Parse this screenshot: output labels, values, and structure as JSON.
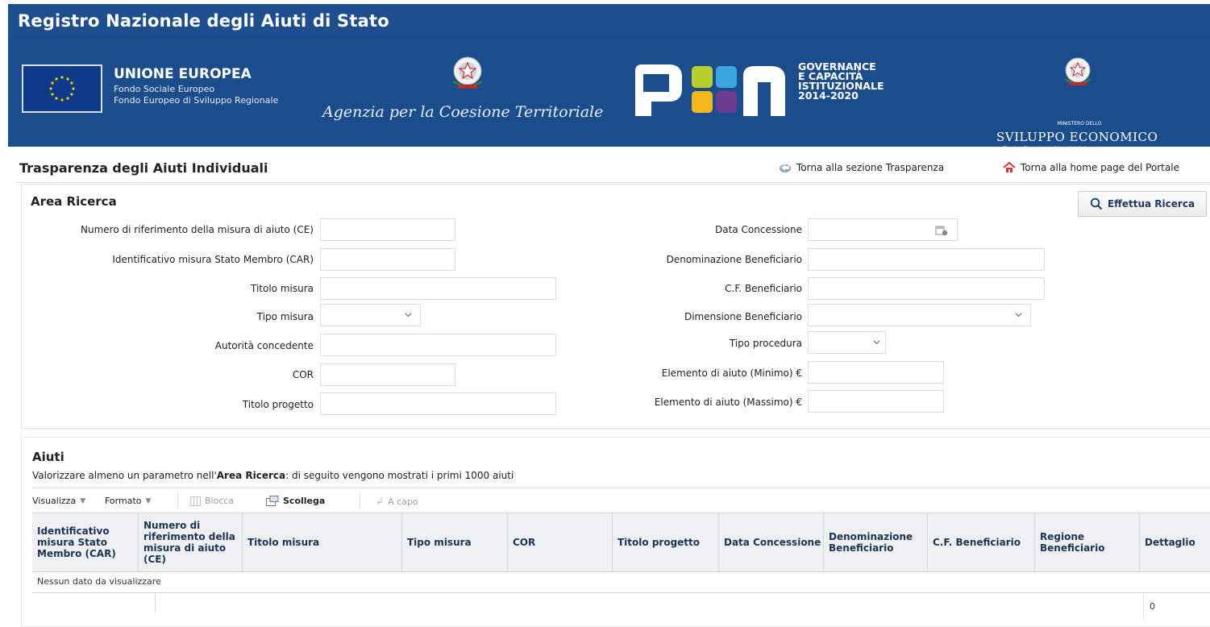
{
  "header": {
    "app_title": "Registro Nazionale degli Aiuti di Stato",
    "eu": {
      "title": "UNIONE EUROPEA",
      "line1": "Fondo Sociale Europeo",
      "line2": "Fondo Europeo di Sviluppo Regionale"
    },
    "agency": "Agenzia per la Coesione Territoriale",
    "pon": {
      "line1": "GOVERNANCE",
      "line2": "E CAPACITÀ",
      "line3": "ISTITUZIONALE",
      "line4": "2014-2020"
    },
    "ministry": {
      "small": "MINISTERO DELLO",
      "title": "SVILUPPO ECONOMICO",
      "sub": "Direzione Generale per gli Incentivi alle Imprese"
    }
  },
  "page": {
    "title": "Trasparenza degli Aiuti Individuali",
    "link_transparency": "Torna alla sezione Trasparenza",
    "link_home": "Torna alla home page del Portale"
  },
  "search": {
    "title": "Area Ricerca",
    "button": "Effettua Ricerca",
    "left_fields": [
      {
        "label": "Numero di riferimento della misura di aiuto (CE)",
        "value": ""
      },
      {
        "label": "Identificativo misura Stato Membro (CAR)",
        "value": ""
      },
      {
        "label": "Titolo misura",
        "value": ""
      },
      {
        "label": "Tipo misura",
        "value": ""
      },
      {
        "label": "Autorità concedente",
        "value": ""
      },
      {
        "label": "COR",
        "value": ""
      },
      {
        "label": "Titolo progetto",
        "value": ""
      }
    ],
    "right_fields": [
      {
        "label": "Data Concessione",
        "value": ""
      },
      {
        "label": "Denominazione Beneficiario",
        "value": ""
      },
      {
        "label": "C.F. Beneficiario",
        "value": ""
      },
      {
        "label": "Dimensione Beneficiario",
        "value": ""
      },
      {
        "label": "Tipo procedura",
        "value": ""
      },
      {
        "label": "Elemento di aiuto (Minimo) €",
        "value": ""
      },
      {
        "label": "Elemento di aiuto (Massimo) €",
        "value": ""
      }
    ]
  },
  "results": {
    "title": "Aiuti",
    "note_prefix": "Valorizzare almeno un parametro nell'",
    "note_bold": "Area Ricerca",
    "note_suffix": ": di seguito vengono mostrati i primi 1000 aiuti",
    "toolbar": {
      "view": "Visualizza",
      "format": "Formato",
      "freeze": "Blocca",
      "detach": "Scollega",
      "wrap": "A capo"
    },
    "columns": [
      "Identificativo misura Stato Membro (CAR)",
      "Numero di riferimento della misura di aiuto (CE)",
      "Titolo misura",
      "Tipo misura",
      "COR",
      "Titolo progetto",
      "Data Concessione",
      "Denominazione Beneficiario",
      "C.F. Beneficiario",
      "Regione Beneficiario",
      "Dettaglio"
    ],
    "empty_message": "Nessun dato da visualizzare",
    "total": "0"
  }
}
